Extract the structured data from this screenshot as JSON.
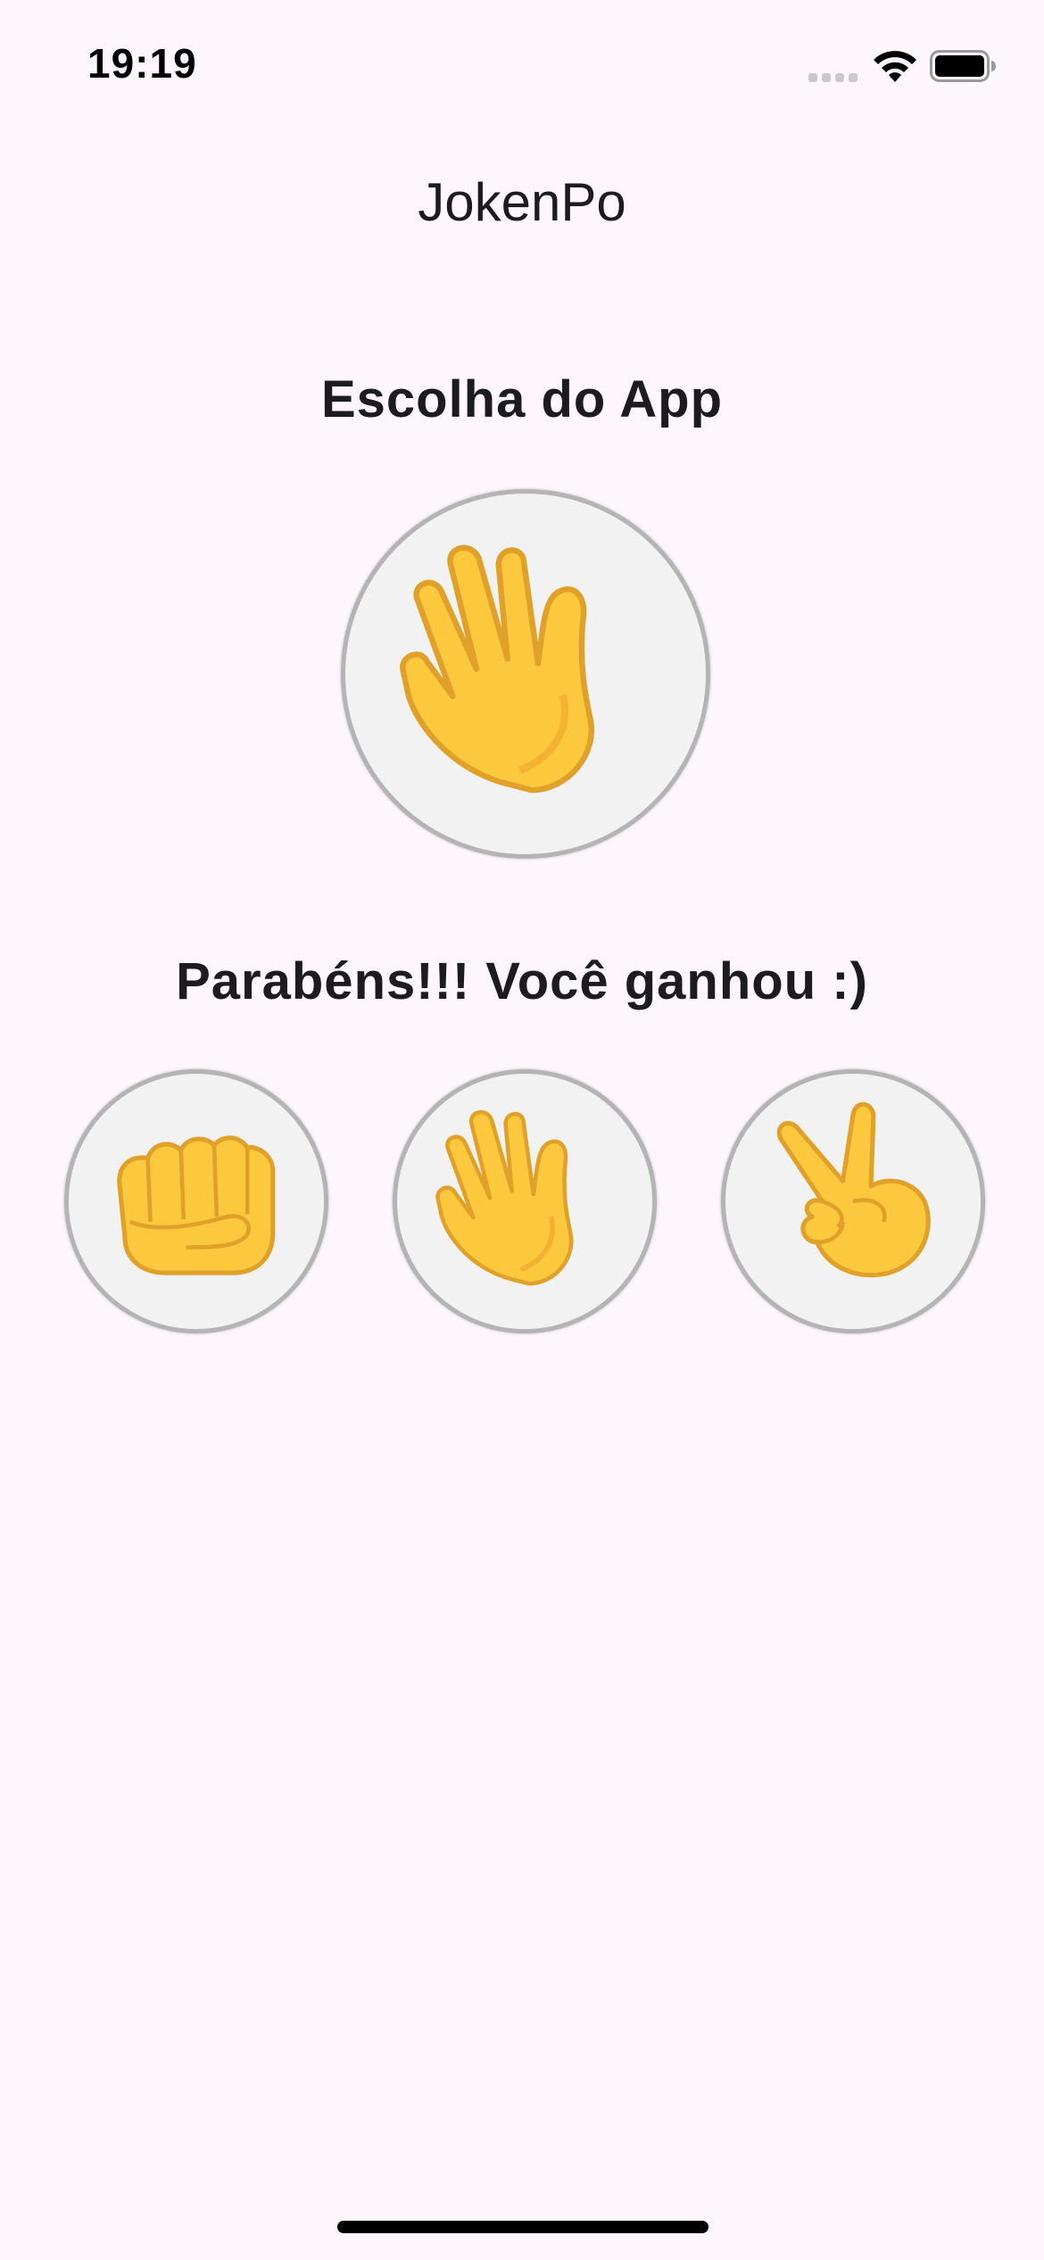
{
  "status_bar": {
    "time": "19:19"
  },
  "app": {
    "title": "JokenPo"
  },
  "app_choice": {
    "heading": "Escolha do App",
    "icon": "raised-hand-icon"
  },
  "result": {
    "message": "Parabéns!!! Você ganhou :)"
  },
  "player_options": [
    {
      "name": "rock",
      "icon": "fist-icon"
    },
    {
      "name": "paper",
      "icon": "raised-hand-icon"
    },
    {
      "name": "scissors",
      "icon": "victory-hand-icon"
    }
  ],
  "colors": {
    "background": "#fdf7fd",
    "text": "#1d1b1f",
    "circle_fill": "#f2f2f2",
    "circle_border": "#b4b4b4",
    "emoji_yellow": "#fcc83d"
  }
}
